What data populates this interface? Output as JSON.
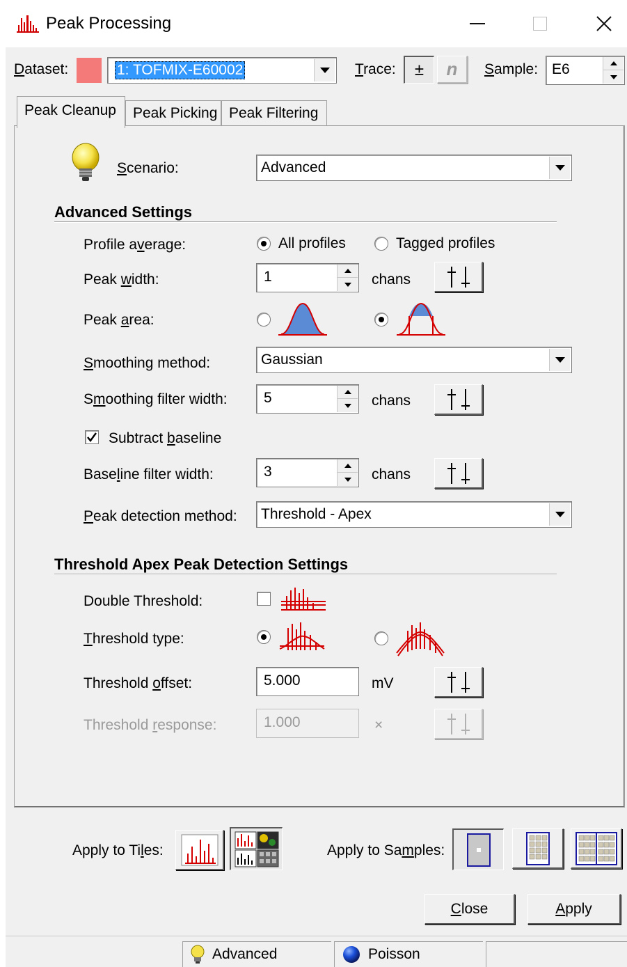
{
  "window": {
    "title": "Peak Processing",
    "controls": [
      "minimize",
      "maximize",
      "close"
    ]
  },
  "toolbar": {
    "dataset_label": "Dataset:",
    "dataset_value": "1: TOFMIX-E60002",
    "dataset_color": "#f47a7a",
    "trace_label": "Trace:",
    "trace_buttons": [
      "±",
      "n"
    ],
    "sample_label": "Sample:",
    "sample_value": "E6"
  },
  "tabs": [
    {
      "label": "Peak Cleanup",
      "active": true
    },
    {
      "label": "Peak Picking",
      "active": false
    },
    {
      "label": "Peak Filtering",
      "active": false
    }
  ],
  "scenario": {
    "label": "Scenario:",
    "value": "Advanced",
    "icon": "lightbulb-icon"
  },
  "advanced": {
    "title": "Advanced Settings",
    "profile_average": {
      "label": "Profile average:",
      "options": [
        "All profiles",
        "Tagged profiles"
      ],
      "selected": "All profiles"
    },
    "peak_width": {
      "label": "Peak width:",
      "value": "1",
      "unit": "chans"
    },
    "peak_area": {
      "label": "Peak area:",
      "options": [
        "full-area-icon",
        "apex-area-icon"
      ],
      "selected": "apex-area-icon"
    },
    "smoothing_method": {
      "label": "Smoothing method:",
      "value": "Gaussian"
    },
    "smoothing_filter_width": {
      "label": "Smoothing filter width:",
      "value": "5",
      "unit": "chans"
    },
    "subtract_baseline": {
      "label": "Subtract baseline",
      "checked": true
    },
    "baseline_filter_width": {
      "label": "Baseline filter width:",
      "value": "3",
      "unit": "chans"
    },
    "peak_detection_method": {
      "label": "Peak detection method:",
      "value": "Threshold - Apex"
    }
  },
  "threshold": {
    "title": "Threshold Apex Peak Detection Settings",
    "double_threshold": {
      "label": "Double Threshold:",
      "checked": false
    },
    "threshold_type": {
      "label": "Threshold type:",
      "options": [
        "flat-threshold-icon",
        "curved-threshold-icon"
      ],
      "selected": "flat-threshold-icon"
    },
    "threshold_offset": {
      "label": "Threshold offset:",
      "value": "5.000",
      "unit": "mV"
    },
    "threshold_response": {
      "label": "Threshold response:",
      "value": "1.000",
      "unit": "×",
      "enabled": false
    }
  },
  "apply": {
    "tiles_label": "Apply to Tiles:",
    "samples_label": "Apply to Samples:",
    "close_label": "Close",
    "apply_label": "Apply"
  },
  "status": {
    "scenario": "Advanced",
    "model": "Poisson"
  },
  "colors": {
    "peak_red": "#d40000",
    "peak_blue": "#4a7fd0",
    "dialog_bg": "#f0f0f0",
    "selection_blue": "#3399ff"
  }
}
